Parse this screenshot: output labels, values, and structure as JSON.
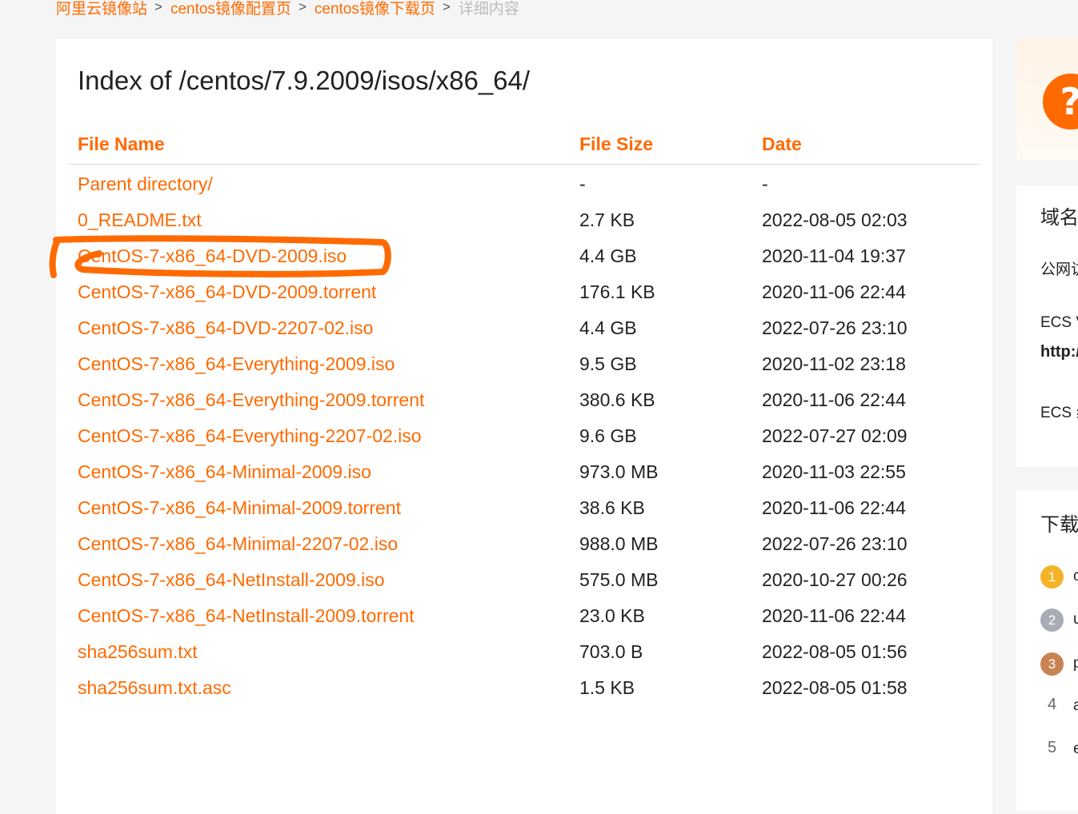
{
  "breadcrumb": {
    "items": [
      "阿里云镜像站",
      "centos镜像配置页",
      "centos镜像下载页",
      "详细内容"
    ],
    "separator": ">"
  },
  "page": {
    "title": "Index of /centos/7.9.2009/isos/x86_64/"
  },
  "table": {
    "headers": {
      "name": "File Name",
      "size": "File Size",
      "date": "Date"
    },
    "rows": [
      {
        "name": "Parent directory/",
        "size": "-",
        "date": "-"
      },
      {
        "name": "0_README.txt",
        "size": "2.7 KB",
        "date": "2022-08-05 02:03"
      },
      {
        "name": "CentOS-7-x86_64-DVD-2009.iso",
        "size": "4.4 GB",
        "date": "2020-11-04 19:37"
      },
      {
        "name": "CentOS-7-x86_64-DVD-2009.torrent",
        "size": "176.1 KB",
        "date": "2020-11-06 22:44"
      },
      {
        "name": "CentOS-7-x86_64-DVD-2207-02.iso",
        "size": "4.4 GB",
        "date": "2022-07-26 23:10"
      },
      {
        "name": "CentOS-7-x86_64-Everything-2009.iso",
        "size": "9.5 GB",
        "date": "2020-11-02 23:18"
      },
      {
        "name": "CentOS-7-x86_64-Everything-2009.torrent",
        "size": "380.6 KB",
        "date": "2020-11-06 22:44"
      },
      {
        "name": "CentOS-7-x86_64-Everything-2207-02.iso",
        "size": "9.6 GB",
        "date": "2022-07-27 02:09"
      },
      {
        "name": "CentOS-7-x86_64-Minimal-2009.iso",
        "size": "973.0 MB",
        "date": "2020-11-03 22:55"
      },
      {
        "name": "CentOS-7-x86_64-Minimal-2009.torrent",
        "size": "38.6 KB",
        "date": "2020-11-06 22:44"
      },
      {
        "name": "CentOS-7-x86_64-Minimal-2207-02.iso",
        "size": "988.0 MB",
        "date": "2022-07-26 23:10"
      },
      {
        "name": "CentOS-7-x86_64-NetInstall-2009.iso",
        "size": "575.0 MB",
        "date": "2020-10-27 00:26"
      },
      {
        "name": "CentOS-7-x86_64-NetInstall-2009.torrent",
        "size": "23.0 KB",
        "date": "2020-11-06 22:44"
      },
      {
        "name": "sha256sum.txt",
        "size": "703.0 B",
        "date": "2022-08-05 01:56"
      },
      {
        "name": "sha256sum.txt.asc",
        "size": "1.5 KB",
        "date": "2022-08-05 01:58"
      }
    ]
  },
  "sidebar": {
    "help_icon": "question-mark-icon",
    "domain_card": {
      "heading": "域名",
      "lines": [
        "公网访",
        "ECS V",
        "http:/",
        "ECS 纟"
      ]
    },
    "downloads_card": {
      "heading": "下载",
      "ranks": [
        {
          "number": "1",
          "text": "c"
        },
        {
          "number": "2",
          "text": "u"
        },
        {
          "number": "3",
          "text": "p"
        },
        {
          "number": "4",
          "text": "a"
        },
        {
          "number": "5",
          "text": "e"
        }
      ]
    }
  },
  "colors": {
    "accent": "#ff6a00",
    "annotation": "#ff6a00",
    "page_background": "#f5f5f5"
  }
}
